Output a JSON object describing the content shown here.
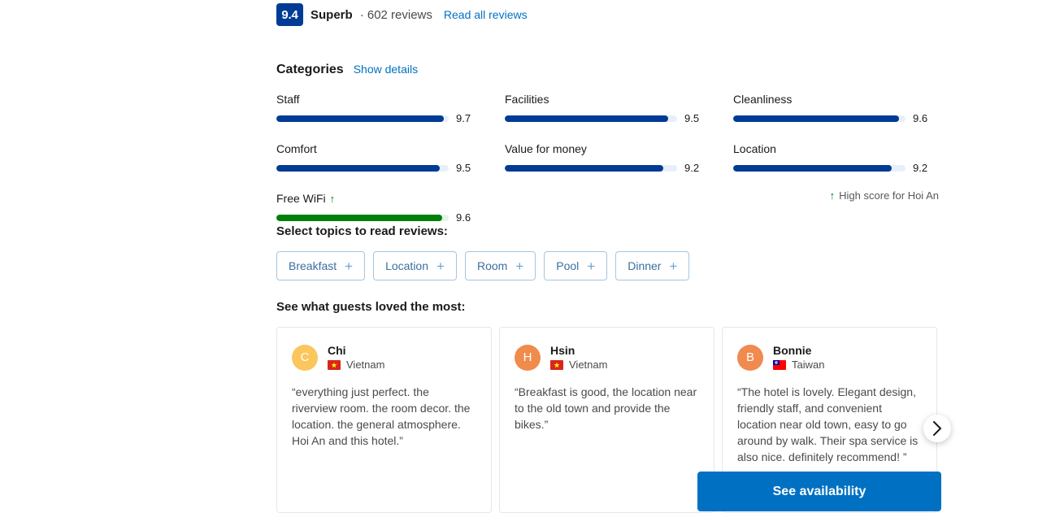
{
  "rating": {
    "score": "9.4",
    "word": "Superb",
    "meta": "· 602 reviews",
    "read_all_label": "Read all reviews",
    "badge_color": "#003b95"
  },
  "categories": {
    "title": "Categories",
    "show_details_label": "Show details",
    "high_score_note": "High score for Hoi An",
    "high_score_arrow": "↑",
    "items": [
      {
        "label": "Staff",
        "score": "9.7",
        "pct": 97,
        "highlight": false
      },
      {
        "label": "Facilities",
        "score": "9.5",
        "pct": 95,
        "highlight": false
      },
      {
        "label": "Cleanliness",
        "score": "9.6",
        "pct": 96,
        "highlight": false
      },
      {
        "label": "Comfort",
        "score": "9.5",
        "pct": 95,
        "highlight": false
      },
      {
        "label": "Value for money",
        "score": "9.2",
        "pct": 92,
        "highlight": false
      },
      {
        "label": "Location",
        "score": "9.2",
        "pct": 92,
        "highlight": false
      },
      {
        "label": "Free WiFi",
        "score": "9.6",
        "pct": 96,
        "highlight": true,
        "arrow": "↑"
      }
    ],
    "bar_color": "#003b95",
    "bar_track_color": "#e7f0fa",
    "highlight_color": "#008009"
  },
  "topics": {
    "title": "Select topics to read reviews:",
    "chips": [
      {
        "label": "Breakfast",
        "icon": "+"
      },
      {
        "label": "Location",
        "icon": "+"
      },
      {
        "label": "Room",
        "icon": "+"
      },
      {
        "label": "Pool",
        "icon": "+"
      },
      {
        "label": "Dinner",
        "icon": "+"
      }
    ]
  },
  "guests_loved": {
    "title": "See what guests loved the most:",
    "reviews": [
      {
        "name": "Chi",
        "initial": "C",
        "avatar_color": "#fbc65b",
        "country": "Vietnam",
        "flag": "vietnam",
        "text": "“everything just perfect. the riverview room. the room decor. the location. the general atmosphere. Hoi An and this hotel.”"
      },
      {
        "name": "Hsin",
        "initial": "H",
        "avatar_color": "#ef8b4b",
        "country": "Vietnam",
        "flag": "vietnam",
        "text": "“Breakfast is good, the location near to the old town and provide the bikes.”"
      },
      {
        "name": "Bonnie",
        "initial": "B",
        "avatar_color": "#f08a4f",
        "country": "Taiwan",
        "flag": "taiwan",
        "text": "“The hotel is lovely. Elegant design, friendly staff, and convenient location near old town, easy to go around by walk. Their spa service is also nice. definitely recommend! ”"
      }
    ],
    "next_label": "›"
  },
  "cta": {
    "see_availability_label": "See availability",
    "color": "#0071c2"
  }
}
